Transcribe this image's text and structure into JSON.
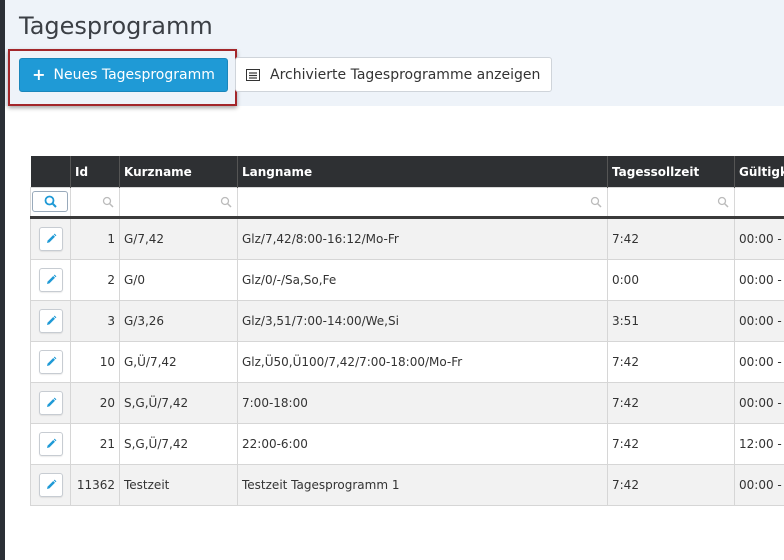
{
  "page": {
    "title": "Tagesprogramm"
  },
  "toolbar": {
    "new_label": "Neues Tagesprogramm",
    "archive_label": "Archivierte Tagesprogramme anzeigen"
  },
  "table": {
    "columns": [
      "Id",
      "Kurzname",
      "Langname",
      "Tagessollzeit",
      "Gültigke"
    ],
    "rows": [
      {
        "id": "1",
        "kurzname": "G/7,42",
        "langname": "Glz/7,42/8:00-16:12/Mo-Fr",
        "sollzeit": "7:42",
        "gueltig": "00:00 -"
      },
      {
        "id": "2",
        "kurzname": "G/0",
        "langname": "Glz/0/-/Sa,So,Fe",
        "sollzeit": "0:00",
        "gueltig": "00:00 -"
      },
      {
        "id": "3",
        "kurzname": "G/3,26",
        "langname": "Glz/3,51/7:00-14:00/We,Si",
        "sollzeit": "3:51",
        "gueltig": "00:00 -"
      },
      {
        "id": "10",
        "kurzname": "G,Ü/7,42",
        "langname": "Glz,Ü50,Ü100/7,42/7:00-18:00/Mo-Fr",
        "sollzeit": "7:42",
        "gueltig": "00:00 -"
      },
      {
        "id": "20",
        "kurzname": "S,G,Ü/7,42",
        "langname": "7:00-18:00",
        "sollzeit": "7:42",
        "gueltig": "00:00 -"
      },
      {
        "id": "21",
        "kurzname": "S,G,Ü/7,42",
        "langname": "22:00-6:00",
        "sollzeit": "7:42",
        "gueltig": "12:00 -"
      },
      {
        "id": "11362",
        "kurzname": "Testzeit",
        "langname": "Testzeit Tagesprogramm 1",
        "sollzeit": "7:42",
        "gueltig": "00:00 -"
      }
    ]
  },
  "colors": {
    "primary": "#1f9ad6",
    "header_bg": "#2e3033",
    "highlight": "#a3262a",
    "band": "#eef3f9"
  },
  "icons": {
    "new": "plus-icon",
    "archive": "list-icon",
    "filter": "search-icon",
    "edit": "pencil-icon"
  }
}
